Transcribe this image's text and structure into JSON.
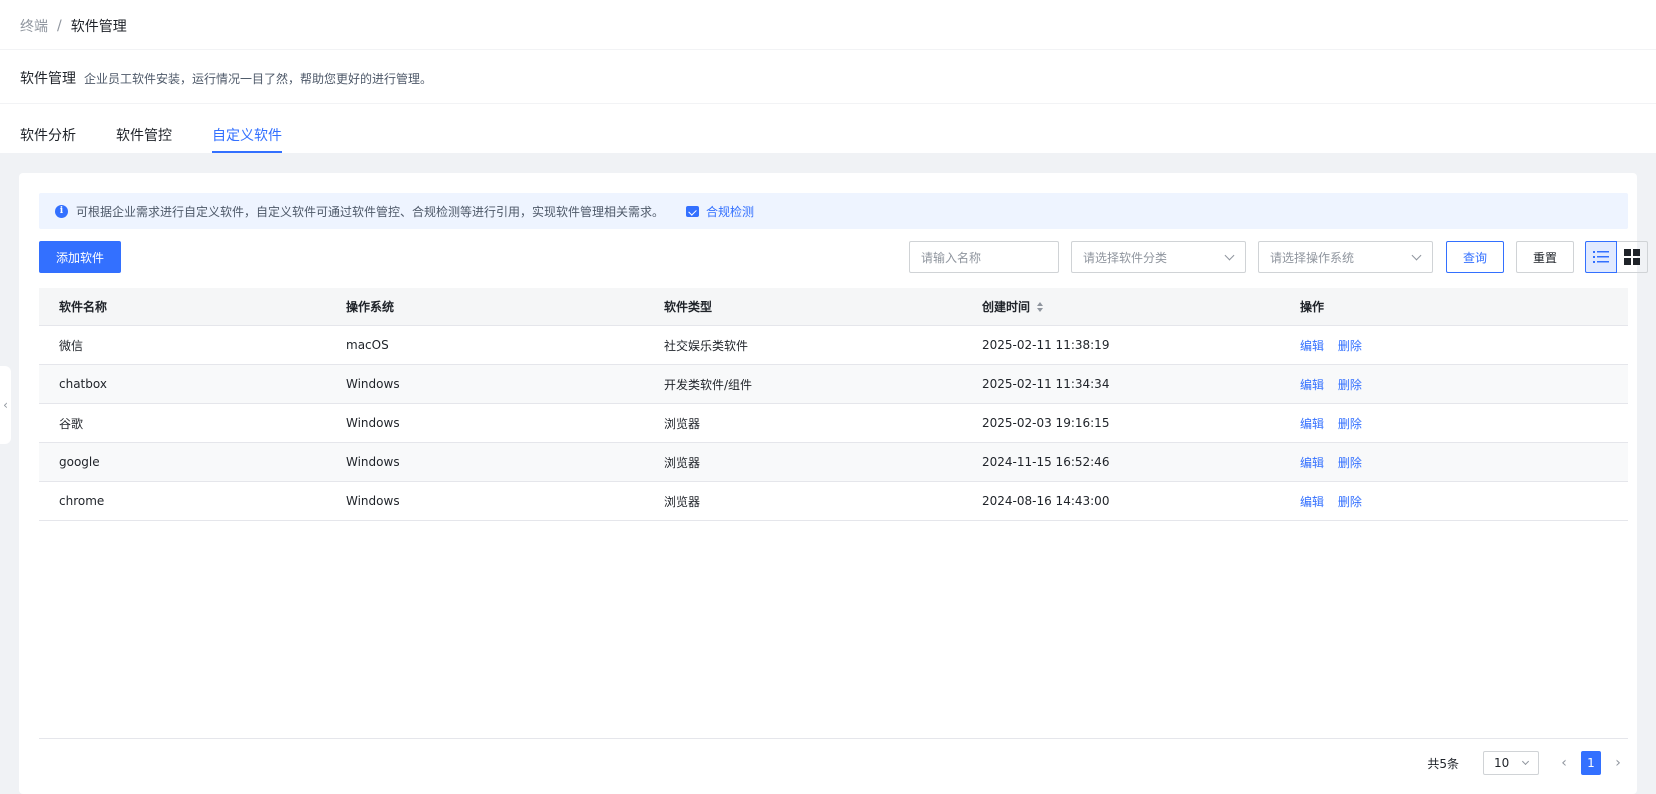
{
  "breadcrumb": {
    "parent": "终端",
    "separator": "/",
    "current": "软件管理"
  },
  "header": {
    "title": "软件管理",
    "subtitle": "企业员工软件安装，运行情况一目了然，帮助您更好的进行管理。"
  },
  "tabs": [
    {
      "label": "软件分析",
      "active": false
    },
    {
      "label": "软件管控",
      "active": false
    },
    {
      "label": "自定义软件",
      "active": true
    }
  ],
  "alert": {
    "icon": "info-icon",
    "text": "可根据企业需求进行自定义软件，自定义软件可通过软件管控、合规检测等进行引用，实现软件管理相关需求。",
    "link_label": "合规检测"
  },
  "toolbar": {
    "add_label": "添加软件",
    "name_placeholder": "请输入名称",
    "category_placeholder": "请选择软件分类",
    "os_placeholder": "请选择操作系统",
    "query_label": "查询",
    "reset_label": "重置",
    "view_mode": "list"
  },
  "table": {
    "columns": [
      "软件名称",
      "操作系统",
      "软件类型",
      "创建时间",
      "操作"
    ],
    "rows": [
      {
        "name": "微信",
        "os": "macOS",
        "type": "社交娱乐类软件",
        "created": "2025-02-11 11:38:19"
      },
      {
        "name": "chatbox",
        "os": "Windows",
        "type": "开发类软件/组件",
        "created": "2025-02-11 11:34:34"
      },
      {
        "name": "谷歌",
        "os": "Windows",
        "type": "浏览器",
        "created": "2025-02-03 19:16:15"
      },
      {
        "name": "google",
        "os": "Windows",
        "type": "浏览器",
        "created": "2024-11-15 16:52:46"
      },
      {
        "name": "chrome",
        "os": "Windows",
        "type": "浏览器",
        "created": "2024-08-16 14:43:00"
      }
    ],
    "edit_label": "编辑",
    "delete_label": "删除"
  },
  "pagination": {
    "total_text": "共5条",
    "page_size": "10",
    "current_page": "1"
  },
  "colors": {
    "accent": "#3370ff",
    "alert_bg": "#eef4ff"
  }
}
